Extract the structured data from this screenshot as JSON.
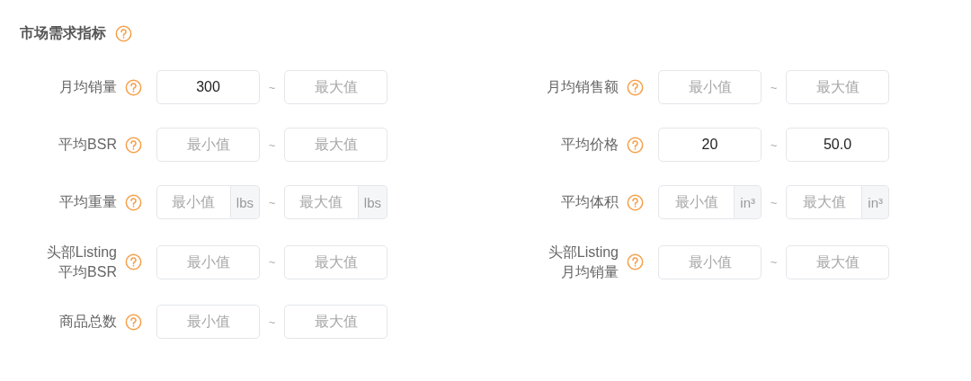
{
  "section": {
    "title": "市场需求指标"
  },
  "filters": [
    {
      "label": "月均销量",
      "min": {
        "value": "300"
      },
      "separator": "~",
      "max": {
        "placeholder": "最大值"
      }
    },
    {
      "label": "月均销售额",
      "min": {
        "placeholder": "最小值"
      },
      "separator": "~",
      "max": {
        "placeholder": "最大值"
      }
    },
    {
      "label": "平均BSR",
      "min": {
        "placeholder": "最小值"
      },
      "separator": "~",
      "max": {
        "placeholder": "最大值"
      }
    },
    {
      "label": "平均价格",
      "min": {
        "value": "20"
      },
      "separator": "~",
      "max": {
        "value": "50.0"
      }
    },
    {
      "label": "平均重量",
      "min": {
        "placeholder": "最小值",
        "unit": "lbs"
      },
      "separator": "~",
      "max": {
        "placeholder": "最大值",
        "unit": "lbs"
      }
    },
    {
      "label": "平均体积",
      "min": {
        "placeholder": "最小值",
        "unit": "in³"
      },
      "separator": "~",
      "max": {
        "placeholder": "最大值",
        "unit": "in³"
      }
    },
    {
      "label": "头部Listing\n平均BSR",
      "min": {
        "placeholder": "最小值"
      },
      "separator": "~",
      "max": {
        "placeholder": "最大值"
      }
    },
    {
      "label": "头部Listing\n月均销量",
      "min": {
        "placeholder": "最小值"
      },
      "separator": "~",
      "max": {
        "placeholder": "最大值"
      }
    },
    {
      "label": "商品总数",
      "min": {
        "placeholder": "最小值"
      },
      "separator": "~",
      "max": {
        "placeholder": "最大值"
      }
    }
  ]
}
